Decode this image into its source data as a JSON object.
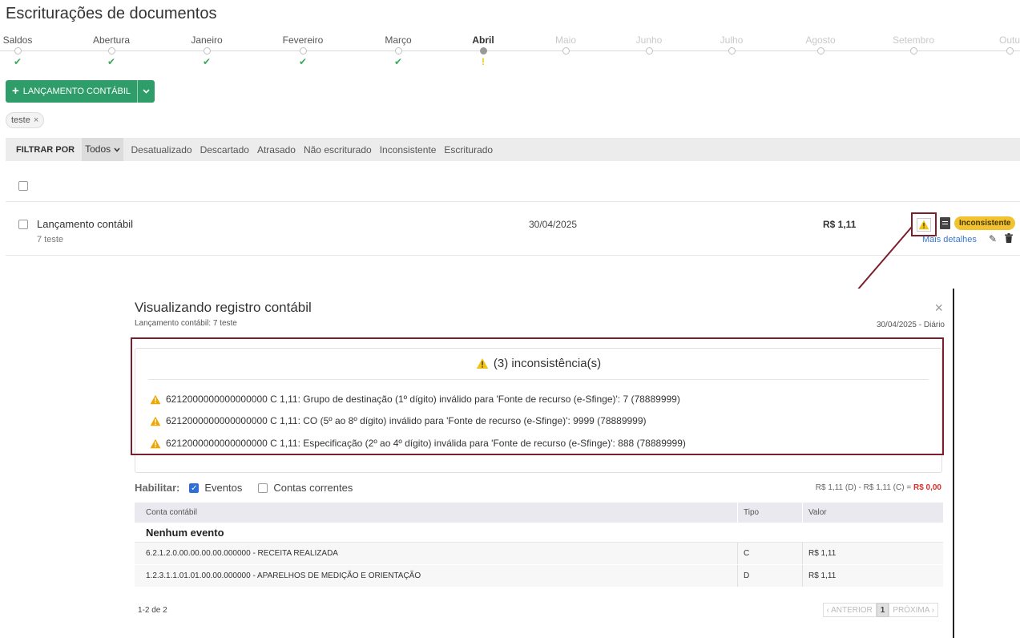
{
  "page": {
    "title": "Escriturações de documentos"
  },
  "timeline": [
    {
      "label": "Saldos",
      "status": "ok"
    },
    {
      "label": "Abertura",
      "status": "ok"
    },
    {
      "label": "Janeiro",
      "status": "ok"
    },
    {
      "label": "Fevereiro",
      "status": "ok"
    },
    {
      "label": "Março",
      "status": "ok"
    },
    {
      "label": "Abril",
      "status": "warning",
      "active": true
    },
    {
      "label": "Maio",
      "status": "future"
    },
    {
      "label": "Junho",
      "status": "future"
    },
    {
      "label": "Julho",
      "status": "future"
    },
    {
      "label": "Agosto",
      "status": "future"
    },
    {
      "label": "Setembro",
      "status": "future"
    },
    {
      "label": "Outu",
      "status": "future"
    }
  ],
  "toolbar": {
    "add_label": "LANÇAMENTO CONTÁBIL",
    "add_plus": "+",
    "caret": "⌄"
  },
  "tag": {
    "label": "teste",
    "close": "×"
  },
  "filter": {
    "label": "FILTRAR POR",
    "selected": "Todos",
    "options": [
      "Desatualizado",
      "Descartado",
      "Atrasado",
      "Não escriturado",
      "Inconsistente",
      "Escriturado"
    ]
  },
  "entry": {
    "title": "Lançamento contábil",
    "subtitle": "7 teste",
    "date": "30/04/2025",
    "value": "R$ 1,11",
    "status": "Inconsistente",
    "more": "Mais detalhes",
    "status_color": "#f1c232"
  },
  "modal": {
    "title": "Visualizando registro contábil",
    "subtitle": "Lançamento contábil: 7 teste",
    "close": "×",
    "date": "30/04/2025 - Diário",
    "inconsistencies_header": "(3) inconsistência(s)",
    "inconsistencies": [
      "6212000000000000000 C 1,11: Grupo de destinação (1º dígito) inválido para 'Fonte de recurso (e-Sfinge)': 7 (78889999)",
      "6212000000000000000 C 1,11: CO (5º ao 8º dígito) inválido para 'Fonte de recurso (e-Sfinge)': 9999 (78889999)",
      "6212000000000000000 C 1,11: Especificação (2º ao 4º dígito) inválida para 'Fonte de recurso (e-Sfinge)': 888 (78889999)"
    ],
    "enable_label": "Habilitar:",
    "events_label": "Eventos",
    "events_checked": true,
    "accounts_label": "Contas correntes",
    "accounts_checked": false,
    "totals_prefix": "R$ 1,11 (D) - R$ 1,11 (C) = ",
    "totals_result": "R$ 0,00",
    "table": {
      "headers": [
        "Conta contábil",
        "Tipo",
        "Valor"
      ],
      "group": "Nenhum evento",
      "rows": [
        {
          "account": "6.2.1.2.0.00.00.00.00.000000 - RECEITA REALIZADA",
          "type": "C",
          "value": "R$ 1,11"
        },
        {
          "account": "1.2.3.1.1.01.01.00.00.000000 - APARELHOS DE MEDIÇÃO E ORIENTAÇÃO",
          "type": "D",
          "value": "R$ 1,11"
        }
      ]
    },
    "pager": {
      "info": "1-2 de 2",
      "prev": "‹ ANTERIOR",
      "current": "1",
      "next": "PRÓXIMA ›"
    }
  },
  "colors": {
    "accent": "#2e9d6a",
    "highlight": "#7a1f2b",
    "warning": "#f0c419",
    "ok": "#3aaa5c"
  },
  "icons": {
    "warning": "warning-triangle-icon",
    "check": "check-icon",
    "doc": "document-icon",
    "edit": "pencil-icon",
    "delete": "trash-icon"
  }
}
